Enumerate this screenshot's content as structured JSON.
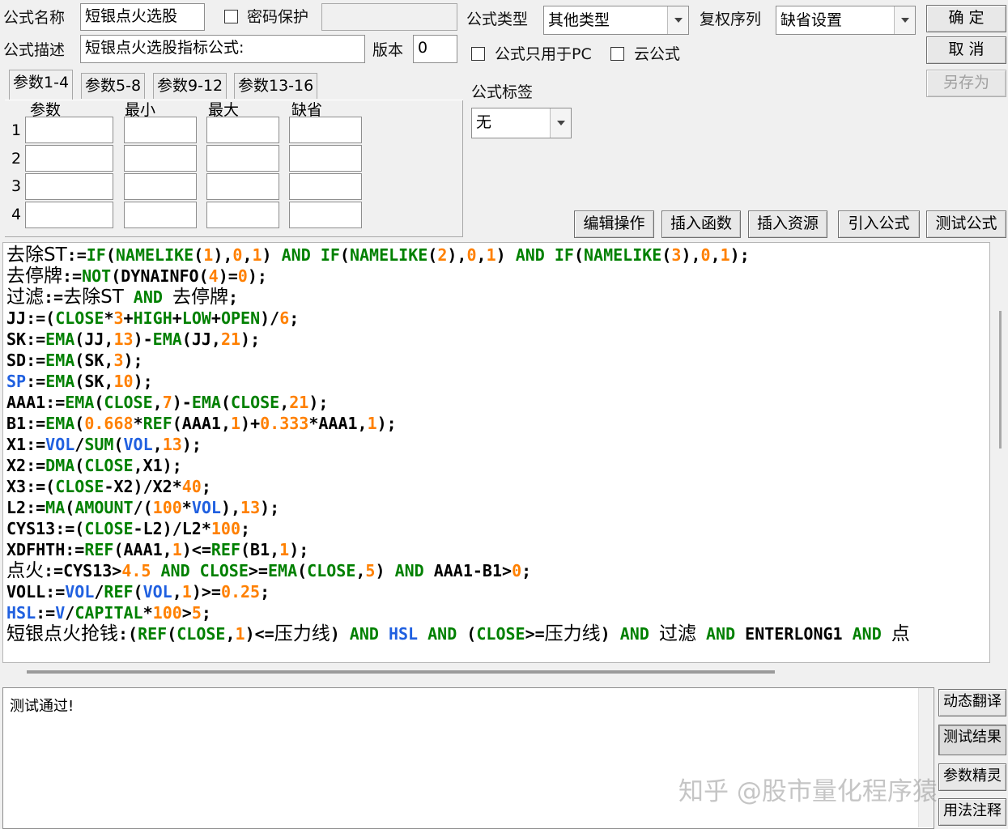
{
  "window": {
    "formula_name_label": "公式名称",
    "formula_name_value": "短银点火选股",
    "password_label": "密码保护",
    "password_value": "",
    "formula_desc_label": "公式描述",
    "formula_desc_value": "短银点火选股指标公式:",
    "version_label": "版本",
    "version_value": "0",
    "formula_type_label": "公式类型",
    "formula_type_value": "其他类型",
    "rights_label": "复权序列",
    "rights_value": "缺省设置",
    "pc_only_label": "公式只用于PC",
    "cloud_label": "云公式",
    "tag_label": "公式标签",
    "tag_value": "无"
  },
  "buttons": {
    "ok": "确  定",
    "cancel": "取  消",
    "save_as": "另存为",
    "edit_ops": "编辑操作",
    "insert_func": "插入函数",
    "insert_resource": "插入资源",
    "import_formula": "引入公式",
    "test_formula": "测试公式",
    "dynamic_translate": "动态翻译",
    "test_result": "测试结果",
    "param_wizard": "参数精灵",
    "usage_notes": "用法注释"
  },
  "params": {
    "tabs": [
      "参数1-4",
      "参数5-8",
      "参数9-12",
      "参数13-16"
    ],
    "active_tab": 0,
    "headers": [
      "参数",
      "最小",
      "最大",
      "缺省"
    ],
    "rows": [
      "1",
      "2",
      "3",
      "4"
    ]
  },
  "code_lines": [
    [
      [
        "去除ST",
        "c"
      ],
      [
        ":=",
        "k"
      ],
      [
        "IF",
        "f"
      ],
      [
        "(",
        "k"
      ],
      [
        "NAMELIKE",
        "f"
      ],
      [
        "(",
        "k"
      ],
      [
        "1",
        "n"
      ],
      [
        "),",
        "k"
      ],
      [
        "0",
        "n"
      ],
      [
        ",",
        "k"
      ],
      [
        "1",
        "n"
      ],
      [
        ") ",
        "k"
      ],
      [
        "AND",
        "f"
      ],
      [
        " ",
        "k"
      ],
      [
        "IF",
        "f"
      ],
      [
        "(",
        "k"
      ],
      [
        "NAMELIKE",
        "f"
      ],
      [
        "(",
        "k"
      ],
      [
        "2",
        "n"
      ],
      [
        "),",
        "k"
      ],
      [
        "0",
        "n"
      ],
      [
        ",",
        "k"
      ],
      [
        "1",
        "n"
      ],
      [
        ") ",
        "k"
      ],
      [
        "AND",
        "f"
      ],
      [
        " ",
        "k"
      ],
      [
        "IF",
        "f"
      ],
      [
        "(",
        "k"
      ],
      [
        "NAMELIKE",
        "f"
      ],
      [
        "(",
        "k"
      ],
      [
        "3",
        "n"
      ],
      [
        "),",
        "k"
      ],
      [
        "0",
        "n"
      ],
      [
        ",",
        "k"
      ],
      [
        "1",
        "n"
      ],
      [
        ");",
        "k"
      ]
    ],
    [
      [
        "去停牌",
        "c"
      ],
      [
        ":=",
        "k"
      ],
      [
        "NOT",
        "f"
      ],
      [
        "(",
        "k"
      ],
      [
        "DYNAINFO",
        "k"
      ],
      [
        "(",
        "k"
      ],
      [
        "4",
        "n"
      ],
      [
        ")=",
        "k"
      ],
      [
        "0",
        "n"
      ],
      [
        ");",
        "k"
      ]
    ],
    [
      [
        "过滤",
        "c"
      ],
      [
        ":=",
        "k"
      ],
      [
        "去除ST",
        "c"
      ],
      [
        " ",
        "k"
      ],
      [
        "AND",
        "f"
      ],
      [
        " ",
        "k"
      ],
      [
        "去停牌",
        "c"
      ],
      [
        ";",
        "k"
      ]
    ],
    [
      [
        "JJ:=(",
        "k"
      ],
      [
        "CLOSE",
        "f"
      ],
      [
        "*",
        "k"
      ],
      [
        "3",
        "n"
      ],
      [
        "+",
        "k"
      ],
      [
        "HIGH",
        "f"
      ],
      [
        "+",
        "k"
      ],
      [
        "LOW",
        "f"
      ],
      [
        "+",
        "k"
      ],
      [
        "OPEN",
        "f"
      ],
      [
        ")/",
        "k"
      ],
      [
        "6",
        "n"
      ],
      [
        ";",
        "k"
      ]
    ],
    [
      [
        "SK:=",
        "k"
      ],
      [
        "EMA",
        "f"
      ],
      [
        "(JJ,",
        "k"
      ],
      [
        "13",
        "n"
      ],
      [
        ")-",
        "k"
      ],
      [
        "EMA",
        "f"
      ],
      [
        "(JJ,",
        "k"
      ],
      [
        "21",
        "n"
      ],
      [
        ");",
        "k"
      ]
    ],
    [
      [
        "SD:=",
        "k"
      ],
      [
        "EMA",
        "f"
      ],
      [
        "(SK,",
        "k"
      ],
      [
        "3",
        "n"
      ],
      [
        ");",
        "k"
      ]
    ],
    [
      [
        "SP",
        "b"
      ],
      [
        ":=",
        "k"
      ],
      [
        "EMA",
        "f"
      ],
      [
        "(SK,",
        "k"
      ],
      [
        "10",
        "n"
      ],
      [
        ");",
        "k"
      ]
    ],
    [
      [
        "AAA1:=",
        "k"
      ],
      [
        "EMA",
        "f"
      ],
      [
        "(",
        "k"
      ],
      [
        "CLOSE",
        "f"
      ],
      [
        ",",
        "k"
      ],
      [
        "7",
        "n"
      ],
      [
        ")-",
        "k"
      ],
      [
        "EMA",
        "f"
      ],
      [
        "(",
        "k"
      ],
      [
        "CLOSE",
        "f"
      ],
      [
        ",",
        "k"
      ],
      [
        "21",
        "n"
      ],
      [
        ");",
        "k"
      ]
    ],
    [
      [
        "B1:=",
        "k"
      ],
      [
        "EMA",
        "f"
      ],
      [
        "(",
        "k"
      ],
      [
        "0.668",
        "n"
      ],
      [
        "*",
        "k"
      ],
      [
        "REF",
        "f"
      ],
      [
        "(AAA1,",
        "k"
      ],
      [
        "1",
        "n"
      ],
      [
        ")+",
        "k"
      ],
      [
        "0.333",
        "n"
      ],
      [
        "*AAA1,",
        "k"
      ],
      [
        "1",
        "n"
      ],
      [
        ");",
        "k"
      ]
    ],
    [
      [
        "X1:=",
        "k"
      ],
      [
        "VOL",
        "b"
      ],
      [
        "/",
        "k"
      ],
      [
        "SUM",
        "f"
      ],
      [
        "(",
        "k"
      ],
      [
        "VOL",
        "b"
      ],
      [
        ",",
        "k"
      ],
      [
        "13",
        "n"
      ],
      [
        ");",
        "k"
      ]
    ],
    [
      [
        "X2:=",
        "k"
      ],
      [
        "DMA",
        "f"
      ],
      [
        "(",
        "k"
      ],
      [
        "CLOSE",
        "f"
      ],
      [
        ",X1);",
        "k"
      ]
    ],
    [
      [
        "X3:=(",
        "k"
      ],
      [
        "CLOSE",
        "f"
      ],
      [
        "-X2)/X2*",
        "k"
      ],
      [
        "40",
        "n"
      ],
      [
        ";",
        "k"
      ]
    ],
    [
      [
        "L2:=",
        "k"
      ],
      [
        "MA",
        "f"
      ],
      [
        "(",
        "k"
      ],
      [
        "AMOUNT",
        "f"
      ],
      [
        "/(",
        "k"
      ],
      [
        "100",
        "n"
      ],
      [
        "*",
        "k"
      ],
      [
        "VOL",
        "b"
      ],
      [
        "),",
        "k"
      ],
      [
        "13",
        "n"
      ],
      [
        ");",
        "k"
      ]
    ],
    [
      [
        "CYS13:=(",
        "k"
      ],
      [
        "CLOSE",
        "f"
      ],
      [
        "-L2)/L2*",
        "k"
      ],
      [
        "100",
        "n"
      ],
      [
        ";",
        "k"
      ]
    ],
    [
      [
        "XDFHTH:=",
        "k"
      ],
      [
        "REF",
        "f"
      ],
      [
        "(AAA1,",
        "k"
      ],
      [
        "1",
        "n"
      ],
      [
        ")<=",
        "k"
      ],
      [
        "REF",
        "f"
      ],
      [
        "(B1,",
        "k"
      ],
      [
        "1",
        "n"
      ],
      [
        ");",
        "k"
      ]
    ],
    [
      [
        "点火",
        "c"
      ],
      [
        ":=CYS13>",
        "k"
      ],
      [
        "4.5",
        "n"
      ],
      [
        " ",
        "k"
      ],
      [
        "AND",
        "f"
      ],
      [
        " ",
        "k"
      ],
      [
        "CLOSE",
        "f"
      ],
      [
        ">=",
        "k"
      ],
      [
        "EMA",
        "f"
      ],
      [
        "(",
        "k"
      ],
      [
        "CLOSE",
        "f"
      ],
      [
        ",",
        "k"
      ],
      [
        "5",
        "n"
      ],
      [
        ") ",
        "k"
      ],
      [
        "AND",
        "f"
      ],
      [
        " AAA1-B1>",
        "k"
      ],
      [
        "0",
        "n"
      ],
      [
        ";",
        "k"
      ]
    ],
    [
      [
        "VOLL:=",
        "k"
      ],
      [
        "VOL",
        "b"
      ],
      [
        "/",
        "k"
      ],
      [
        "REF",
        "f"
      ],
      [
        "(",
        "k"
      ],
      [
        "VOL",
        "b"
      ],
      [
        ",",
        "k"
      ],
      [
        "1",
        "n"
      ],
      [
        ")>=",
        "k"
      ],
      [
        "0.25",
        "n"
      ],
      [
        ";",
        "k"
      ]
    ],
    [
      [
        "HSL",
        "b"
      ],
      [
        ":=",
        "k"
      ],
      [
        "V",
        "b"
      ],
      [
        "/",
        "k"
      ],
      [
        "CAPITAL",
        "f"
      ],
      [
        "*",
        "k"
      ],
      [
        "100",
        "n"
      ],
      [
        ">",
        "k"
      ],
      [
        "5",
        "n"
      ],
      [
        ";",
        "k"
      ]
    ],
    [
      [
        "短银点火抢钱",
        "c"
      ],
      [
        ":(",
        "k"
      ],
      [
        "REF",
        "f"
      ],
      [
        "(",
        "k"
      ],
      [
        "CLOSE",
        "f"
      ],
      [
        ",",
        "k"
      ],
      [
        "1",
        "n"
      ],
      [
        ")<=",
        "k"
      ],
      [
        "压力线",
        "c"
      ],
      [
        ") ",
        "k"
      ],
      [
        "AND",
        "f"
      ],
      [
        " ",
        "k"
      ],
      [
        "HSL",
        "b"
      ],
      [
        " ",
        "k"
      ],
      [
        "AND",
        "f"
      ],
      [
        " (",
        "k"
      ],
      [
        "CLOSE",
        "f"
      ],
      [
        ">=",
        "k"
      ],
      [
        "压力线",
        "c"
      ],
      [
        ") ",
        "k"
      ],
      [
        "AND",
        "f"
      ],
      [
        " ",
        "k"
      ],
      [
        "过滤",
        "c"
      ],
      [
        " ",
        "k"
      ],
      [
        "AND",
        "f"
      ],
      [
        " ENTERLONG1 ",
        "k"
      ],
      [
        "AND",
        "f"
      ],
      [
        " ",
        "k"
      ],
      [
        "点",
        "c"
      ]
    ]
  ],
  "colors": {
    "k": "#000000",
    "f": "#008000",
    "n": "#ff8000",
    "b": "#2060e0",
    "c": "#000000"
  },
  "output": {
    "message": "测试通过!"
  },
  "watermark": "知乎 @股市量化程序猿"
}
